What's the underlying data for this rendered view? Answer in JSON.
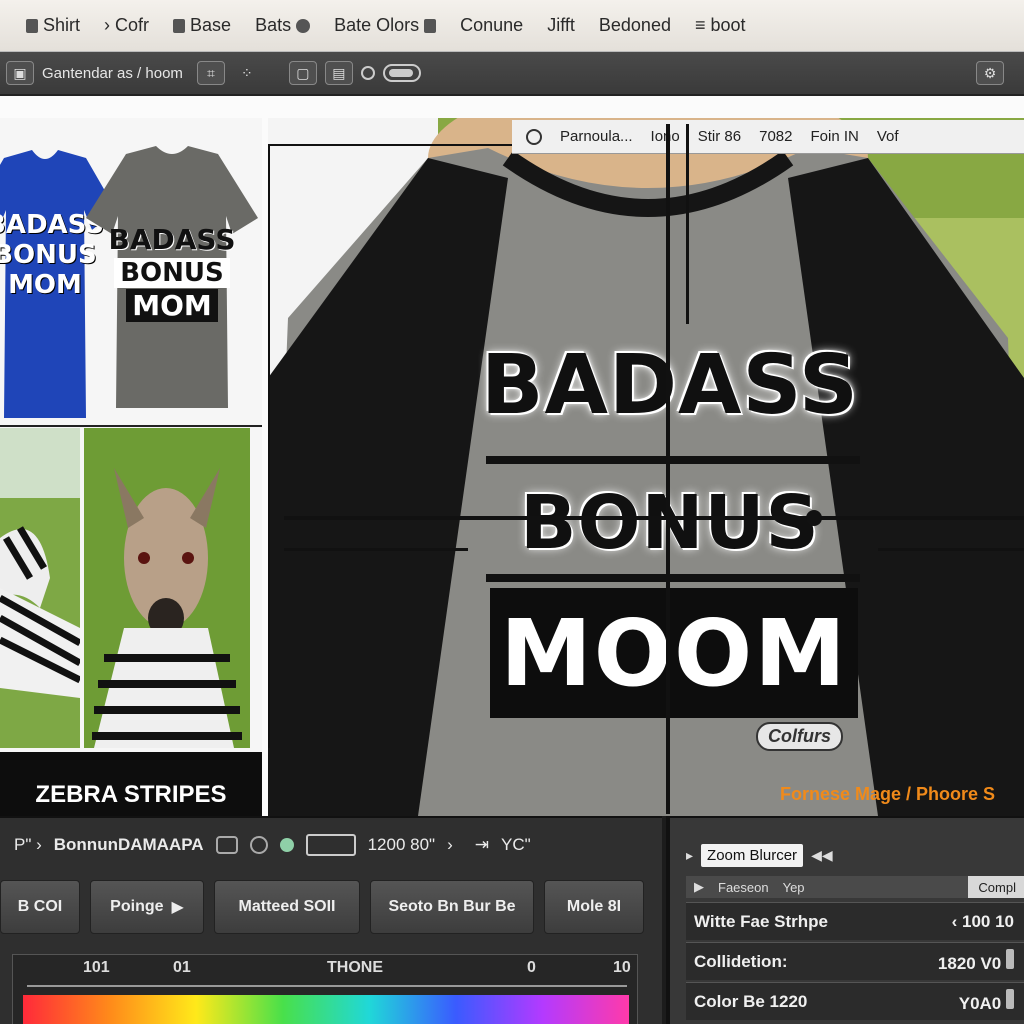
{
  "menubar": {
    "items": [
      "Shirt",
      "Cofr",
      "Base",
      "Bats",
      "Bate Olors",
      "Conune",
      "Jifft",
      "Bedoned",
      "boot"
    ]
  },
  "toolbar": {
    "label": "Gantendar as / hoom"
  },
  "gallery": {
    "shirt_blue_lines": [
      "BADASS",
      "BONUS",
      "MOM"
    ],
    "shirt_gray_lines": [
      "BADASS",
      "BONUS",
      "MOM"
    ],
    "caption": "ZEBRA STRIPES"
  },
  "preview": {
    "header_items": [
      "Parnoula...",
      "Iono",
      "Stir 86",
      "7082",
      "Foin IN",
      "Vof"
    ],
    "print_line1": "BADASS",
    "print_line2": "BONUS",
    "print_line3": "MOOM",
    "tag": "Colfurs",
    "footer_brand": "Fornese Mage / Phoore S"
  },
  "bottom_left": {
    "row1_label": "BonnunDAMAAPA",
    "row1_value": "1200 80\"",
    "row1_right": "YC\"",
    "buttons": [
      "B COI",
      "Poinge",
      "Matteed SOII",
      "Seoto Bn Bur Be",
      "Mole 8I"
    ],
    "ruler_labels": [
      "101",
      "01",
      "THONE",
      "0",
      "10"
    ]
  },
  "bottom_right": {
    "tab_label": "Zoom Blurcer",
    "sub_left": "Faeseon",
    "sub_mid": "Yep",
    "sub_right": "Compl",
    "rows": [
      {
        "label": "Witte Fae Strhpe",
        "value": "100  10"
      },
      {
        "label": "Collidetion:",
        "value": "1820 V0"
      },
      {
        "label": "Color Be 1220",
        "value": "Y0A0"
      }
    ]
  },
  "colors": {
    "menubar_bg": "#ece8e2",
    "toolbar_bg": "#404040",
    "accent_orange": "#f08a1a",
    "shirt_blue": "#1f45b8",
    "shirt_gray": "#6a6a66"
  }
}
